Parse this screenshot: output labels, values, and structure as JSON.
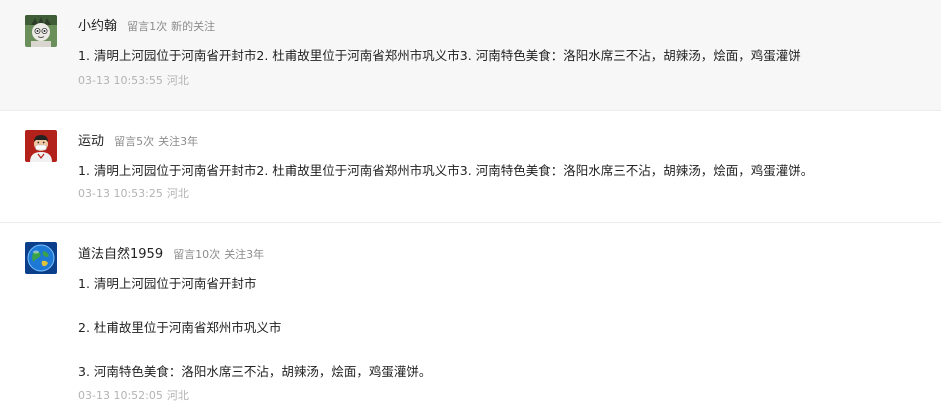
{
  "comments": [
    {
      "nickname": "小约翰",
      "msg_count": "留言1次",
      "follow": "新的关注",
      "avatar_icon": "cartoon-character-avatar",
      "text": "1. 清明上河园位于河南省开封市2. 杜甫故里位于河南省郑州市巩义市3. 河南特色美食：洛阳水席三不沾，胡辣汤，烩面，鸡蛋灌饼",
      "time": "03-13 10:53:55",
      "location": "河北"
    },
    {
      "nickname": "运动",
      "msg_count": "留言5次",
      "follow": "关注3年",
      "avatar_icon": "masked-person-avatar",
      "text": "1. 清明上河园位于河南省开封市2. 杜甫故里位于河南省郑州市巩义市3. 河南特色美食：洛阳水席三不沾，胡辣汤，烩面，鸡蛋灌饼。",
      "time": "03-13 10:53:25",
      "location": "河北"
    },
    {
      "nickname": "道法自然1959",
      "msg_count": "留言10次",
      "follow": "关注3年",
      "avatar_icon": "globe-avatar",
      "paragraphs": [
        "1. 清明上河园位于河南省开封市",
        "2. 杜甫故里位于河南省郑州市巩义市",
        "3. 河南特色美食：洛阳水席三不沾，胡辣汤，烩面，鸡蛋灌饼。"
      ],
      "time": "03-13 10:52:05",
      "location": "河北"
    }
  ],
  "colors": {
    "highlight_row_bg": "#f7f7f7",
    "meta_gray": "#8c8c8c",
    "footer_gray": "#b3b3b3",
    "text": "#222222"
  }
}
